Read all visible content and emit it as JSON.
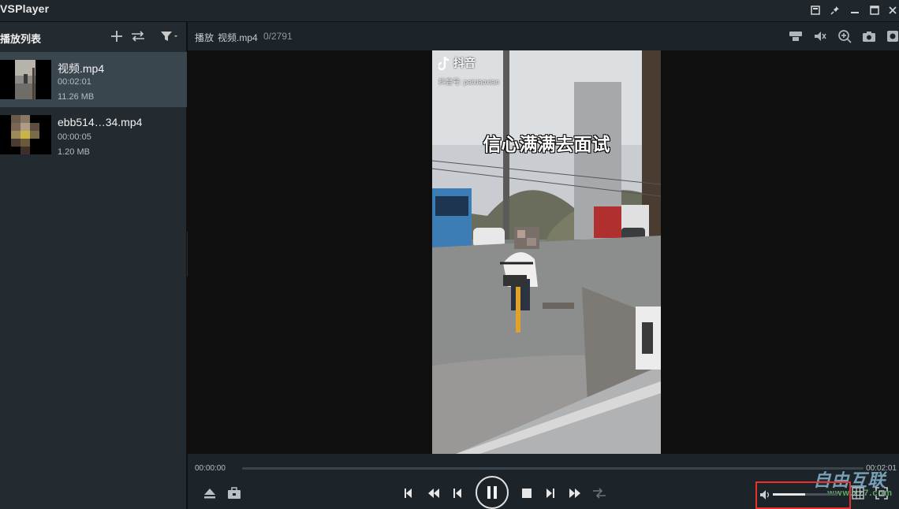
{
  "app": {
    "title": "VSPlayer"
  },
  "sidebar": {
    "title": "播放列表",
    "items": [
      {
        "name": "视频.mp4",
        "duration": "00:02:01",
        "size": "11.26 MB",
        "selected": true
      },
      {
        "name": "ebb514…34.mp4",
        "duration": "00:00:05",
        "size": "1.20 MB",
        "selected": false
      }
    ]
  },
  "info": {
    "label": "播放",
    "file": "视频.mp4",
    "frame": "0/2791"
  },
  "video": {
    "tiktok_brand": "抖音",
    "tiktok_id": "抖音号: paixiaoxian",
    "caption": "信心满满去面试"
  },
  "controls": {
    "time_start": "00:00:00",
    "time_end": "00:02:01",
    "progress": 0.0,
    "volume": 0.5
  },
  "watermark": {
    "text": "自由互联",
    "url": "www.xz7.com"
  },
  "colors": {
    "highlight_box": "#e8312b",
    "selected_row": "#3a464e"
  }
}
